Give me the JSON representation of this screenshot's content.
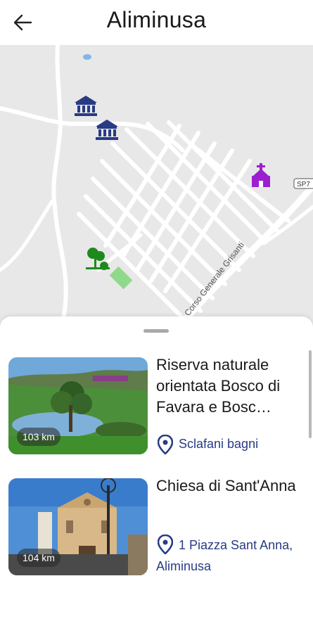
{
  "header": {
    "title": "Aliminusa",
    "back_icon": "arrow-left-icon"
  },
  "map": {
    "street_label": "Corso Generale Grisanti",
    "road_shield": "SP7",
    "markers": [
      "museum-icon",
      "museum-icon",
      "church-icon",
      "park-icon"
    ]
  },
  "places": [
    {
      "title": "Riserva naturale orientata Bosco di Favara e Bosc…",
      "distance": "103 km",
      "location": "Sclafani bagni"
    },
    {
      "title": "Chiesa di Sant'Anna",
      "distance": "104 km",
      "location": "1 Piazza Sant Anna, Aliminusa"
    }
  ],
  "colors": {
    "accent": "#283b84",
    "church": "#9b1fd1",
    "park": "#1e8a1e"
  }
}
